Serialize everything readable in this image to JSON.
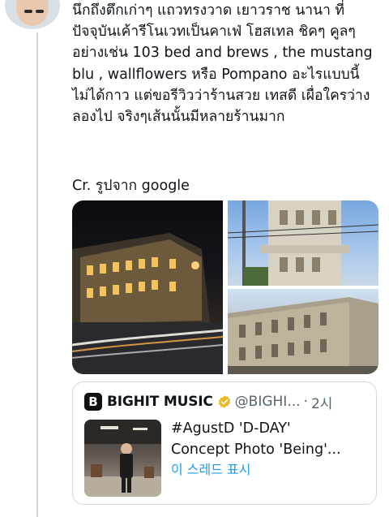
{
  "post": {
    "text": "นึกถึงตึกเก่าๆ แถวทรงวาด เยาวราช นานา ที่ปัจจุบันเค้ารีโนเวทเป็นคาเฟ่ โฮสเทล ชิคๆ คูลๆ อย่างเช่น 103 bed and brews , the mustang blu , wallflowers หรือ Pompano อะไรแบบนี้ ไม่ได้กาว แต่ขอรีวิวว่าร้านสวย เทสดี เผื่อใครว่างลองไป จริงๆเส้นนั้นมีหลายร้านมาก",
    "credit": "Cr. รูปจาก google"
  },
  "media": {
    "count": 3,
    "icons": [
      "night-street-building-photo",
      "colonial-building-photo",
      "old-shophouse-row-photo"
    ]
  },
  "quote": {
    "logo_letter": "B",
    "account_name": "BIGHIT MUSIC",
    "verified": "gold-verified-badge",
    "handle": "@BIGHI...",
    "dot": "·",
    "time": "2시",
    "text_line1": "#AgustD 'D-DAY'",
    "text_line2": "Concept Photo 'Being'...",
    "show_thread": "이 스레드 표시"
  },
  "colors": {
    "link": "#1d9bf0",
    "muted": "#536471",
    "border": "#cfd9de",
    "badge": "#e8b923"
  }
}
